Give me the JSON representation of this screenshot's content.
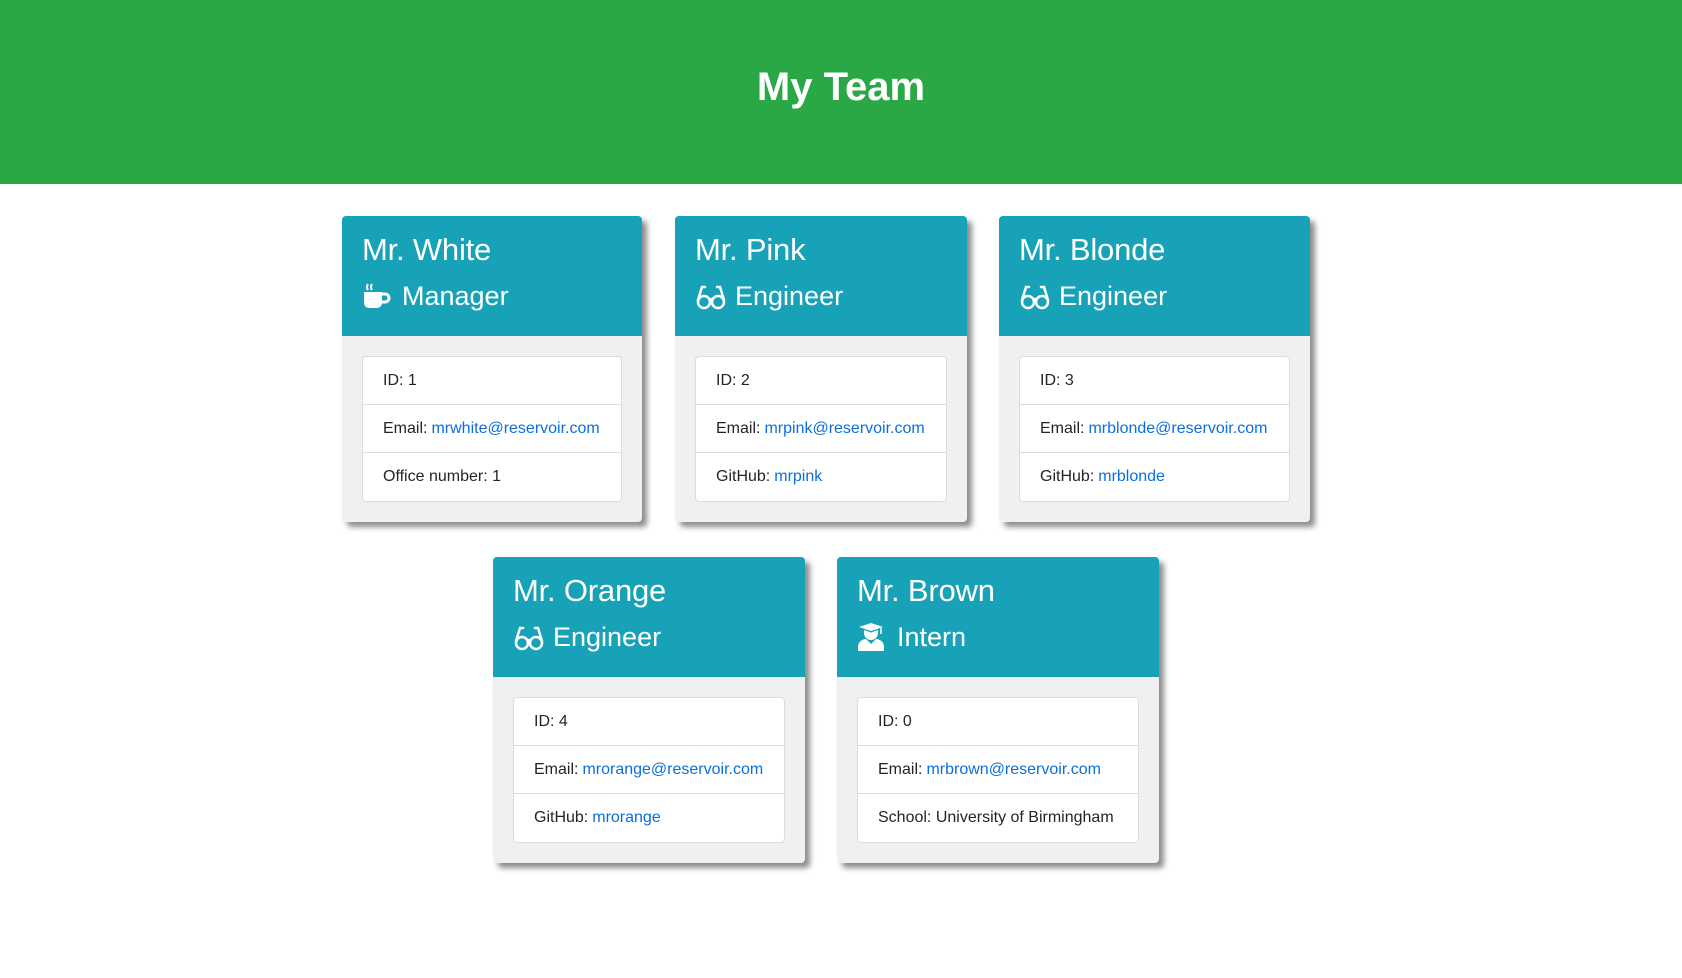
{
  "header": {
    "title": "My Team"
  },
  "colors": {
    "header_bg": "#2ba846",
    "card_header_bg": "#18a2b8",
    "link": "#0a6fdc"
  },
  "cards": [
    {
      "name": "Mr. White",
      "role": "Manager",
      "icon": "coffee-icon",
      "id_label": "ID:",
      "id": "1",
      "email_label": "Email:",
      "email": "mrwhite@reservoir.com",
      "extra_label": "Office number:",
      "extra_value": "1"
    },
    {
      "name": "Mr. Pink",
      "role": "Engineer",
      "icon": "glasses-icon",
      "id_label": "ID:",
      "id": "2",
      "email_label": "Email:",
      "email": "mrpink@reservoir.com",
      "extra_label": "GitHub:",
      "extra_value": "mrpink"
    },
    {
      "name": "Mr. Blonde",
      "role": "Engineer",
      "icon": "glasses-icon",
      "id_label": "ID:",
      "id": "3",
      "email_label": "Email:",
      "email": "mrblonde@reservoir.com",
      "extra_label": "GitHub:",
      "extra_value": "mrblonde"
    },
    {
      "name": "Mr. Orange",
      "role": "Engineer",
      "icon": "glasses-icon",
      "id_label": "ID:",
      "id": "4",
      "email_label": "Email:",
      "email": "mrorange@reservoir.com",
      "extra_label": "GitHub:",
      "extra_value": "mrorange"
    },
    {
      "name": "Mr. Brown",
      "role": "Intern",
      "icon": "graduate-icon",
      "id_label": "ID:",
      "id": "0",
      "email_label": "Email:",
      "email": "mrbrown@reservoir.com",
      "extra_label": "School:",
      "extra_value": "University of Birmingham"
    }
  ]
}
